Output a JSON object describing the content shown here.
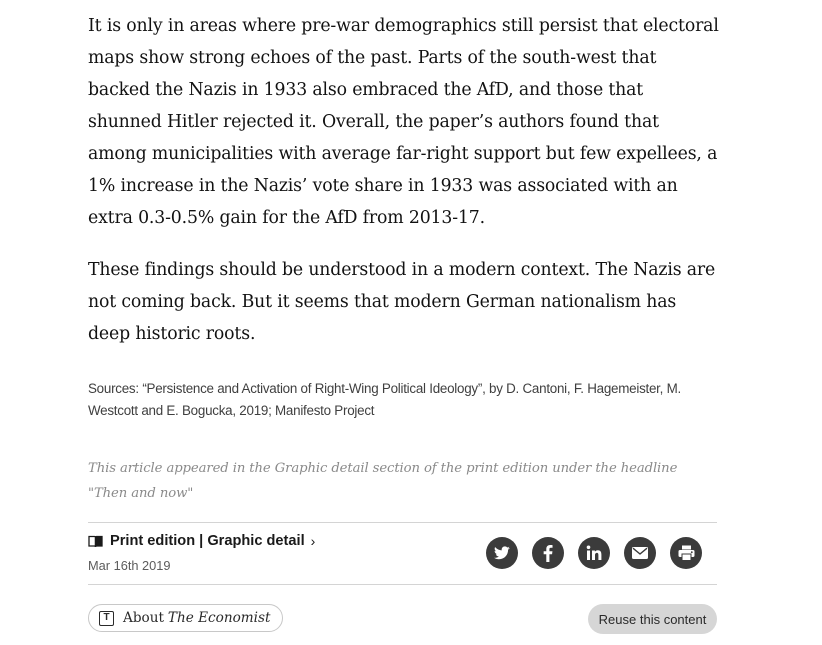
{
  "article": {
    "paragraphs": [
      "It is only in areas where pre-war demographics still persist that electoral maps show strong echoes of the past. Parts of the south-west that backed the Nazis in 1933 also embraced the AfD, and those that shunned Hitler rejected it. Overall, the paper’s authors found that among municipalities with average far-right support but few expellees, a 1% increase in the Nazis’ vote share in 1933 was associated with an extra 0.3-0.5% gain for the AfD from 2013-17.",
      "These findings should be understood in a modern context. The Nazis are not coming back. But it seems that modern German nationalism has deep historic roots."
    ],
    "sources": "Sources: “Persistence and Activation of Right-Wing Political Ideology”, by D. Cantoni, F. Hagemeister, M. Westcott and E. Bogucka, 2019; Manifesto Project",
    "appeared_note": "This article appeared in the Graphic detail section of the print edition under the headline \"Then and now\""
  },
  "footer": {
    "edition_label": "Print edition | Graphic detail",
    "edition_chevron": "›",
    "date": "Mar 16th 2019",
    "share_icons": [
      "twitter-icon",
      "facebook-icon",
      "linkedin-icon",
      "email-icon",
      "print-icon"
    ],
    "about_label": "About",
    "about_brand": "The Economist",
    "about_icon_letter": "T",
    "reuse_label": "Reuse this content"
  },
  "colors": {
    "text": "#121212",
    "muted": "#8a8a8a",
    "share_circle": "#3b3b3b",
    "reuse_bg": "#d6d6d6"
  }
}
